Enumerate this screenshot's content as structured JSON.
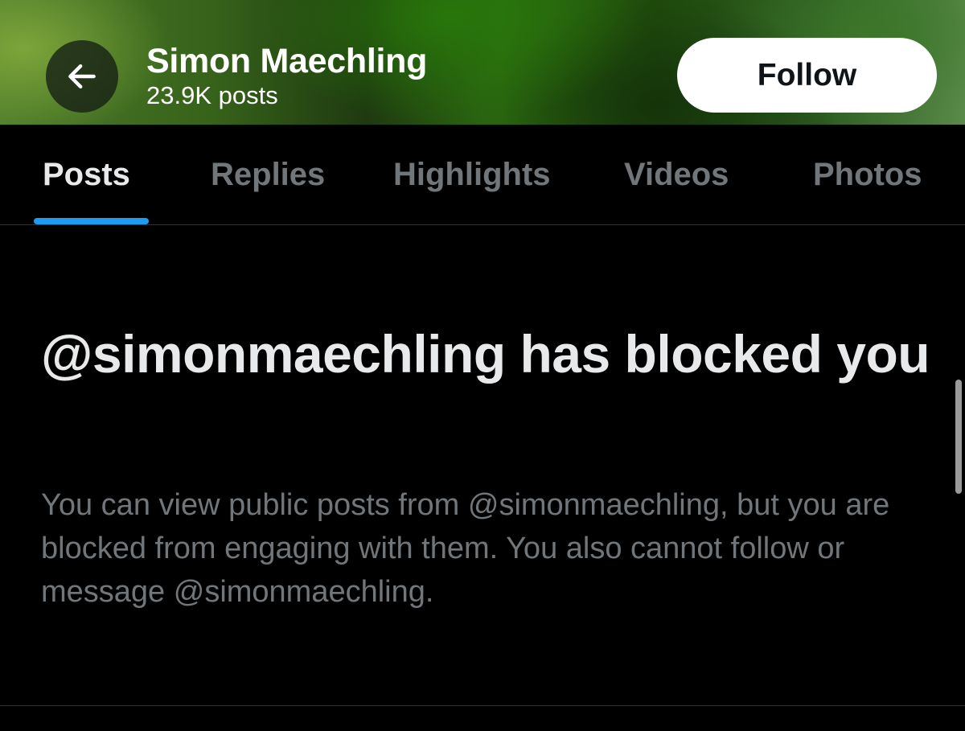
{
  "header": {
    "back_icon": "arrow-left-icon",
    "name": "Simon Maechling",
    "post_count": "23.9K posts",
    "follow_label": "Follow"
  },
  "tabs": [
    {
      "label": "Posts",
      "active": true
    },
    {
      "label": "Replies",
      "active": false
    },
    {
      "label": "Highlights",
      "active": false
    },
    {
      "label": "Videos",
      "active": false
    },
    {
      "label": "Photos",
      "active": false
    }
  ],
  "blocked": {
    "title": "@simonmaechling has blocked you",
    "description": "You can view public posts from @simonmaechling, but you are blocked from engaging with them. You also cannot follow or message @simonmaechling."
  },
  "colors": {
    "background": "#000000",
    "primary_text": "#e7e9ea",
    "secondary_text": "#71767b",
    "accent": "#1d9bf0",
    "follow_button_bg": "#ffffff",
    "divider": "#2f3336"
  }
}
